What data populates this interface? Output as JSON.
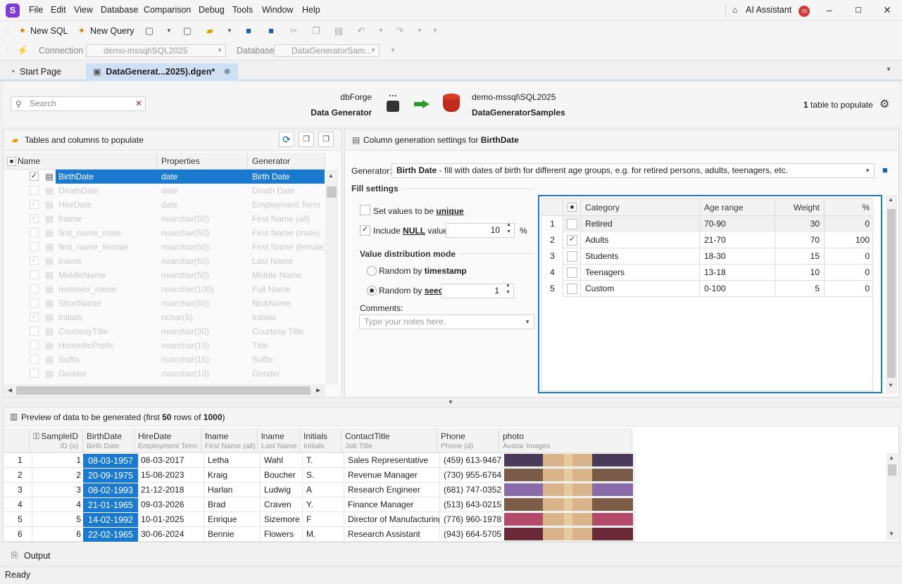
{
  "menu": {
    "items": [
      "File",
      "Edit",
      "View",
      "Database",
      "Comparison",
      "Debug",
      "Tools",
      "Window",
      "Help"
    ],
    "ai_assistant": "AI Assistant",
    "user_initials": "JS"
  },
  "toolbar": {
    "new_sql": "New SQL",
    "new_query": "New Query",
    "connection_label": "Connection",
    "connection_value": "demo-mssql\\SQL2025",
    "database_label": "Database",
    "database_value": "DataGeneratorSam..."
  },
  "tabs": {
    "start": "Start Page",
    "doc": "DataGenerat...2025).dgen*"
  },
  "header": {
    "search_placeholder": "Search",
    "source_top": "dbForge",
    "source_bottom": "Data Generator",
    "target_top": "demo-mssql\\SQL2025",
    "target_bottom": "DataGeneratorSamples",
    "count": "1",
    "count_suffix": " table to populate"
  },
  "left_panel": {
    "title": "Tables and columns to populate",
    "columns": [
      "Name",
      "Properties",
      "Generator"
    ],
    "rows": [
      {
        "name": "BirthDate",
        "props": "date",
        "gen": "Birth Date",
        "checked": true,
        "selected": true,
        "faded": false
      },
      {
        "name": "DeathDate",
        "props": "date",
        "gen": "Death Date",
        "checked": false,
        "selected": false,
        "faded": true
      },
      {
        "name": "HireDate",
        "props": "date",
        "gen": "Employment Term",
        "checked": true,
        "selected": false,
        "faded": true
      },
      {
        "name": "fname",
        "props": "nvarchar(50)",
        "gen": "First Name (all)",
        "checked": true,
        "selected": false,
        "faded": true
      },
      {
        "name": "first_name_male",
        "props": "nvarchar(50)",
        "gen": "First Name (male)",
        "checked": false,
        "selected": false,
        "faded": true
      },
      {
        "name": "first_name_female",
        "props": "nvarchar(50)",
        "gen": "First Name (female)",
        "checked": false,
        "selected": false,
        "faded": true
      },
      {
        "name": "lname",
        "props": "nvarchar(60)",
        "gen": "Last Name",
        "checked": true,
        "selected": false,
        "faded": true
      },
      {
        "name": "MiddleName",
        "props": "nvarchar(50)",
        "gen": "Middle Name",
        "checked": false,
        "selected": false,
        "faded": true
      },
      {
        "name": "reviewer_name",
        "props": "nvarchar(100)",
        "gen": "Full Name",
        "checked": false,
        "selected": false,
        "faded": true
      },
      {
        "name": "ShortName",
        "props": "nvarchar(60)",
        "gen": "NickName",
        "checked": false,
        "selected": false,
        "faded": true
      },
      {
        "name": "Initials",
        "props": "nchar(5)",
        "gen": "Initials",
        "checked": true,
        "selected": false,
        "faded": true
      },
      {
        "name": "CourtesyTitle",
        "props": "nvarchar(30)",
        "gen": "Courtesy Title",
        "checked": false,
        "selected": false,
        "faded": true
      },
      {
        "name": "HonorificPrefix",
        "props": "nvarchar(15)",
        "gen": "Title",
        "checked": false,
        "selected": false,
        "faded": true
      },
      {
        "name": "Suffix",
        "props": "nvarchar(15)",
        "gen": "Suffix",
        "checked": false,
        "selected": false,
        "faded": true
      },
      {
        "name": "Gender",
        "props": "nvarchar(10)",
        "gen": "Gender",
        "checked": false,
        "selected": false,
        "faded": true
      }
    ]
  },
  "right_panel": {
    "title_prefix": "Column generation settings for ",
    "title_column": "BirthDate",
    "generator_label": "Generator:",
    "generator_name": "Birth Date",
    "generator_desc": " - fill with dates of birth for different age groups, e.g. for retired persons, adults, teenagers, etc.",
    "fill_settings": "Fill settings",
    "unique_label": "Set values to be ",
    "unique_bold": "unique",
    "null_label": "Include ",
    "null_bold": "NULL",
    "null_label2": " values",
    "null_value": "10",
    "null_unit": "%",
    "dist_mode": "Value distribution mode",
    "random_ts": "Random by ",
    "random_ts_bold": "timestamp",
    "random_seed": "Random by ",
    "random_seed_bold": "seed",
    "seed_value": "1",
    "comments_label": "Comments:",
    "comments_placeholder": "Type your notes here.",
    "cat_columns": [
      "Category",
      "Age range",
      "Weight",
      "%"
    ],
    "categories": [
      {
        "num": "1",
        "name": "Retired",
        "range": "70-90",
        "weight": "30",
        "pct": "0",
        "checked": false
      },
      {
        "num": "2",
        "name": "Adults",
        "range": "21-70",
        "weight": "70",
        "pct": "100",
        "checked": true
      },
      {
        "num": "3",
        "name": "Students",
        "range": "18-30",
        "weight": "15",
        "pct": "0",
        "checked": false
      },
      {
        "num": "4",
        "name": "Teenagers",
        "range": "13-18",
        "weight": "10",
        "pct": "0",
        "checked": false
      },
      {
        "num": "5",
        "name": "Custom",
        "range": "0-100",
        "weight": "5",
        "pct": "0",
        "checked": false
      }
    ]
  },
  "preview": {
    "title_prefix": "Preview of data to be generated (first ",
    "rows_count": "50",
    "title_mid": " rows of ",
    "total": "1000",
    "title_suffix": ")",
    "columns": [
      {
        "name": "SampleID",
        "sub": "ID (s)"
      },
      {
        "name": "BirthDate",
        "sub": "Birth Date"
      },
      {
        "name": "HireDate",
        "sub": "Employment Term"
      },
      {
        "name": "fname",
        "sub": "First Name (all)"
      },
      {
        "name": "lname",
        "sub": "Last Name"
      },
      {
        "name": "Initials",
        "sub": "Initials"
      },
      {
        "name": "ContactTitle",
        "sub": "Job Title"
      },
      {
        "name": "Phone",
        "sub": "Phone (d)"
      },
      {
        "name": "photo",
        "sub": "Avatar Images"
      }
    ],
    "rows": [
      {
        "n": "1",
        "id": "1",
        "birth": "08-03-1957",
        "hire": "08-03-2017",
        "fname": "Letha",
        "lname": "Wahl",
        "init": "T.",
        "title": "Sales Representative",
        "phone": "(459) 613-9467",
        "photo_color": "#4a3a5a"
      },
      {
        "n": "2",
        "id": "2",
        "birth": "20-09-1975",
        "hire": "15-08-2023",
        "fname": "Kraig",
        "lname": "Boucher",
        "init": "S.",
        "title": "Revenue Manager",
        "phone": "(730) 955-6764",
        "photo_color": "#7a5a48"
      },
      {
        "n": "3",
        "id": "3",
        "birth": "08-02-1993",
        "hire": "21-12-2018",
        "fname": "Harlan",
        "lname": "Ludwig",
        "init": "A",
        "title": "Research Engineer",
        "phone": "(681) 747-0352",
        "photo_color": "#8a6aa8"
      },
      {
        "n": "4",
        "id": "4",
        "birth": "21-01-1965",
        "hire": "09-03-2026",
        "fname": "Brad",
        "lname": "Craven",
        "init": "Y.",
        "title": "Finance Manager",
        "phone": "(513) 643-0215",
        "photo_color": "#7a5c48"
      },
      {
        "n": "5",
        "id": "5",
        "birth": "14-02-1992",
        "hire": "10-01-2025",
        "fname": "Enrique",
        "lname": "Sizemore",
        "init": "F",
        "title": "Director of Manufacturing",
        "phone": "(776) 960-1978",
        "photo_color": "#b44a6a"
      },
      {
        "n": "6",
        "id": "6",
        "birth": "22-02-1965",
        "hire": "30-06-2024",
        "fname": "Bennie",
        "lname": "Flowers",
        "init": "M.",
        "title": "Research Assistant",
        "phone": "(943) 664-5705",
        "photo_color": "#6a2a3a"
      }
    ]
  },
  "output_label": "Output",
  "status": "Ready"
}
